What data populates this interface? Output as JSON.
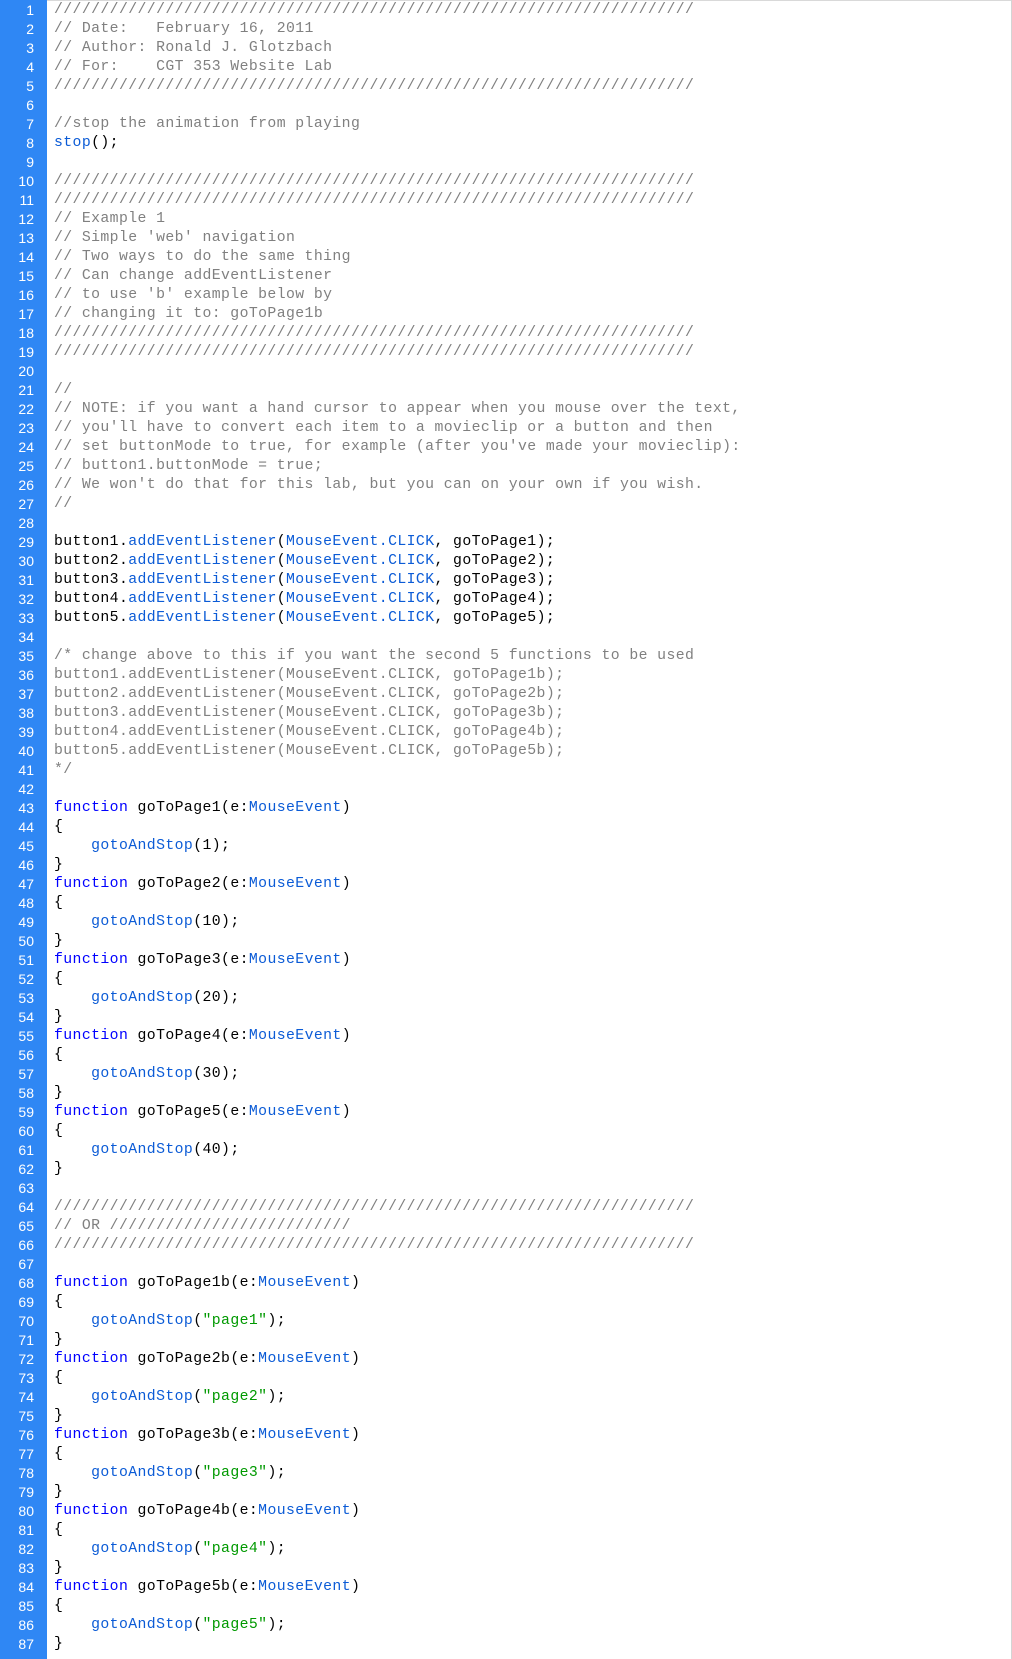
{
  "editor": {
    "colors": {
      "gutter": "#2f87f4",
      "comment": "#808080",
      "keyword": "#0000ff",
      "function": "#0b5bd6",
      "string": "#009900",
      "plain": "#000000"
    },
    "lines": [
      {
        "num": "1",
        "tokens": [
          {
            "t": "c",
            "v": "/////////////////////////////////////////////////////////////////////"
          }
        ]
      },
      {
        "num": "2",
        "tokens": [
          {
            "t": "c",
            "v": "// Date:   February 16, 2011"
          }
        ]
      },
      {
        "num": "3",
        "tokens": [
          {
            "t": "c",
            "v": "// Author: Ronald J. Glotzbach"
          }
        ]
      },
      {
        "num": "4",
        "tokens": [
          {
            "t": "c",
            "v": "// For:    CGT 353 Website Lab"
          }
        ]
      },
      {
        "num": "5",
        "tokens": [
          {
            "t": "c",
            "v": "/////////////////////////////////////////////////////////////////////"
          }
        ]
      },
      {
        "num": "6",
        "tokens": []
      },
      {
        "num": "7",
        "tokens": [
          {
            "t": "c",
            "v": "//stop the animation from playing"
          }
        ]
      },
      {
        "num": "8",
        "tokens": [
          {
            "t": "f",
            "v": "stop"
          },
          {
            "t": "p",
            "v": "();"
          }
        ]
      },
      {
        "num": "9",
        "tokens": []
      },
      {
        "num": "10",
        "tokens": [
          {
            "t": "c",
            "v": "/////////////////////////////////////////////////////////////////////"
          }
        ]
      },
      {
        "num": "11",
        "tokens": [
          {
            "t": "c",
            "v": "/////////////////////////////////////////////////////////////////////"
          }
        ]
      },
      {
        "num": "12",
        "tokens": [
          {
            "t": "c",
            "v": "// Example 1"
          }
        ]
      },
      {
        "num": "13",
        "tokens": [
          {
            "t": "c",
            "v": "// Simple 'web' navigation"
          }
        ]
      },
      {
        "num": "14",
        "tokens": [
          {
            "t": "c",
            "v": "// Two ways to do the same thing"
          }
        ]
      },
      {
        "num": "15",
        "tokens": [
          {
            "t": "c",
            "v": "// Can change addEventListener"
          }
        ]
      },
      {
        "num": "16",
        "tokens": [
          {
            "t": "c",
            "v": "// to use 'b' example below by"
          }
        ]
      },
      {
        "num": "17",
        "tokens": [
          {
            "t": "c",
            "v": "// changing it to: goToPage1b"
          }
        ]
      },
      {
        "num": "18",
        "tokens": [
          {
            "t": "c",
            "v": "/////////////////////////////////////////////////////////////////////"
          }
        ]
      },
      {
        "num": "19",
        "tokens": [
          {
            "t": "c",
            "v": "/////////////////////////////////////////////////////////////////////"
          }
        ]
      },
      {
        "num": "20",
        "tokens": []
      },
      {
        "num": "21",
        "tokens": [
          {
            "t": "c",
            "v": "//"
          }
        ]
      },
      {
        "num": "22",
        "tokens": [
          {
            "t": "c",
            "v": "// NOTE: if you want a hand cursor to appear when you mouse over the text,"
          }
        ]
      },
      {
        "num": "23",
        "tokens": [
          {
            "t": "c",
            "v": "// you'll have to convert each item to a movieclip or a button and then"
          }
        ]
      },
      {
        "num": "24",
        "tokens": [
          {
            "t": "c",
            "v": "// set buttonMode to true, for example (after you've made your movieclip):"
          }
        ]
      },
      {
        "num": "25",
        "tokens": [
          {
            "t": "c",
            "v": "// button1.buttonMode = true;"
          }
        ]
      },
      {
        "num": "26",
        "tokens": [
          {
            "t": "c",
            "v": "// We won't do that for this lab, but you can on your own if you wish."
          }
        ]
      },
      {
        "num": "27",
        "tokens": [
          {
            "t": "c",
            "v": "//"
          }
        ]
      },
      {
        "num": "28",
        "tokens": []
      },
      {
        "num": "29",
        "tokens": [
          {
            "t": "p",
            "v": "button1."
          },
          {
            "t": "f",
            "v": "addEventListener"
          },
          {
            "t": "p",
            "v": "("
          },
          {
            "t": "f",
            "v": "MouseEvent.CLICK"
          },
          {
            "t": "p",
            "v": ", goToPage1);"
          }
        ]
      },
      {
        "num": "30",
        "tokens": [
          {
            "t": "p",
            "v": "button2."
          },
          {
            "t": "f",
            "v": "addEventListener"
          },
          {
            "t": "p",
            "v": "("
          },
          {
            "t": "f",
            "v": "MouseEvent.CLICK"
          },
          {
            "t": "p",
            "v": ", goToPage2);"
          }
        ]
      },
      {
        "num": "31",
        "tokens": [
          {
            "t": "p",
            "v": "button3."
          },
          {
            "t": "f",
            "v": "addEventListener"
          },
          {
            "t": "p",
            "v": "("
          },
          {
            "t": "f",
            "v": "MouseEvent.CLICK"
          },
          {
            "t": "p",
            "v": ", goToPage3);"
          }
        ]
      },
      {
        "num": "32",
        "tokens": [
          {
            "t": "p",
            "v": "button4."
          },
          {
            "t": "f",
            "v": "addEventListener"
          },
          {
            "t": "p",
            "v": "("
          },
          {
            "t": "f",
            "v": "MouseEvent.CLICK"
          },
          {
            "t": "p",
            "v": ", goToPage4);"
          }
        ]
      },
      {
        "num": "33",
        "tokens": [
          {
            "t": "p",
            "v": "button5."
          },
          {
            "t": "f",
            "v": "addEventListener"
          },
          {
            "t": "p",
            "v": "("
          },
          {
            "t": "f",
            "v": "MouseEvent.CLICK"
          },
          {
            "t": "p",
            "v": ", goToPage5);"
          }
        ]
      },
      {
        "num": "34",
        "tokens": []
      },
      {
        "num": "35",
        "tokens": [
          {
            "t": "c",
            "v": "/* change above to this if you want the second 5 functions to be used"
          }
        ]
      },
      {
        "num": "36",
        "tokens": [
          {
            "t": "c",
            "v": "button1.addEventListener(MouseEvent.CLICK, goToPage1b);"
          }
        ]
      },
      {
        "num": "37",
        "tokens": [
          {
            "t": "c",
            "v": "button2.addEventListener(MouseEvent.CLICK, goToPage2b);"
          }
        ]
      },
      {
        "num": "38",
        "tokens": [
          {
            "t": "c",
            "v": "button3.addEventListener(MouseEvent.CLICK, goToPage3b);"
          }
        ]
      },
      {
        "num": "39",
        "tokens": [
          {
            "t": "c",
            "v": "button4.addEventListener(MouseEvent.CLICK, goToPage4b);"
          }
        ]
      },
      {
        "num": "40",
        "tokens": [
          {
            "t": "c",
            "v": "button5.addEventListener(MouseEvent.CLICK, goToPage5b);"
          }
        ]
      },
      {
        "num": "41",
        "tokens": [
          {
            "t": "c",
            "v": "*/"
          }
        ]
      },
      {
        "num": "42",
        "tokens": []
      },
      {
        "num": "43",
        "tokens": [
          {
            "t": "k",
            "v": "function"
          },
          {
            "t": "p",
            "v": " goToPage1(e:"
          },
          {
            "t": "y",
            "v": "MouseEvent"
          },
          {
            "t": "p",
            "v": ")"
          }
        ]
      },
      {
        "num": "44",
        "tokens": [
          {
            "t": "p",
            "v": "{"
          }
        ]
      },
      {
        "num": "45",
        "tokens": [
          {
            "t": "p",
            "v": "    "
          },
          {
            "t": "f",
            "v": "gotoAndStop"
          },
          {
            "t": "p",
            "v": "(1);"
          }
        ]
      },
      {
        "num": "46",
        "tokens": [
          {
            "t": "p",
            "v": "}"
          }
        ]
      },
      {
        "num": "47",
        "tokens": [
          {
            "t": "k",
            "v": "function"
          },
          {
            "t": "p",
            "v": " goToPage2(e:"
          },
          {
            "t": "y",
            "v": "MouseEvent"
          },
          {
            "t": "p",
            "v": ")"
          }
        ]
      },
      {
        "num": "48",
        "tokens": [
          {
            "t": "p",
            "v": "{"
          }
        ]
      },
      {
        "num": "49",
        "tokens": [
          {
            "t": "p",
            "v": "    "
          },
          {
            "t": "f",
            "v": "gotoAndStop"
          },
          {
            "t": "p",
            "v": "(10);"
          }
        ]
      },
      {
        "num": "50",
        "tokens": [
          {
            "t": "p",
            "v": "}"
          }
        ]
      },
      {
        "num": "51",
        "tokens": [
          {
            "t": "k",
            "v": "function"
          },
          {
            "t": "p",
            "v": " goToPage3(e:"
          },
          {
            "t": "y",
            "v": "MouseEvent"
          },
          {
            "t": "p",
            "v": ")"
          }
        ]
      },
      {
        "num": "52",
        "tokens": [
          {
            "t": "p",
            "v": "{"
          }
        ]
      },
      {
        "num": "53",
        "tokens": [
          {
            "t": "p",
            "v": "    "
          },
          {
            "t": "f",
            "v": "gotoAndStop"
          },
          {
            "t": "p",
            "v": "(20);"
          }
        ]
      },
      {
        "num": "54",
        "tokens": [
          {
            "t": "p",
            "v": "}"
          }
        ]
      },
      {
        "num": "55",
        "tokens": [
          {
            "t": "k",
            "v": "function"
          },
          {
            "t": "p",
            "v": " goToPage4(e:"
          },
          {
            "t": "y",
            "v": "MouseEvent"
          },
          {
            "t": "p",
            "v": ")"
          }
        ]
      },
      {
        "num": "56",
        "tokens": [
          {
            "t": "p",
            "v": "{"
          }
        ]
      },
      {
        "num": "57",
        "tokens": [
          {
            "t": "p",
            "v": "    "
          },
          {
            "t": "f",
            "v": "gotoAndStop"
          },
          {
            "t": "p",
            "v": "(30);"
          }
        ]
      },
      {
        "num": "58",
        "tokens": [
          {
            "t": "p",
            "v": "}"
          }
        ]
      },
      {
        "num": "59",
        "tokens": [
          {
            "t": "k",
            "v": "function"
          },
          {
            "t": "p",
            "v": " goToPage5(e:"
          },
          {
            "t": "y",
            "v": "MouseEvent"
          },
          {
            "t": "p",
            "v": ")"
          }
        ]
      },
      {
        "num": "60",
        "tokens": [
          {
            "t": "p",
            "v": "{"
          }
        ]
      },
      {
        "num": "61",
        "tokens": [
          {
            "t": "p",
            "v": "    "
          },
          {
            "t": "f",
            "v": "gotoAndStop"
          },
          {
            "t": "p",
            "v": "(40);"
          }
        ]
      },
      {
        "num": "62",
        "tokens": [
          {
            "t": "p",
            "v": "}"
          }
        ]
      },
      {
        "num": "63",
        "tokens": []
      },
      {
        "num": "64",
        "tokens": [
          {
            "t": "c",
            "v": "/////////////////////////////////////////////////////////////////////"
          }
        ]
      },
      {
        "num": "65",
        "tokens": [
          {
            "t": "c",
            "v": "// OR //////////////////////////"
          }
        ]
      },
      {
        "num": "66",
        "tokens": [
          {
            "t": "c",
            "v": "/////////////////////////////////////////////////////////////////////"
          }
        ]
      },
      {
        "num": "67",
        "tokens": []
      },
      {
        "num": "68",
        "tokens": [
          {
            "t": "k",
            "v": "function"
          },
          {
            "t": "p",
            "v": " goToPage1b(e:"
          },
          {
            "t": "y",
            "v": "MouseEvent"
          },
          {
            "t": "p",
            "v": ")"
          }
        ]
      },
      {
        "num": "69",
        "tokens": [
          {
            "t": "p",
            "v": "{"
          }
        ]
      },
      {
        "num": "70",
        "tokens": [
          {
            "t": "p",
            "v": "    "
          },
          {
            "t": "f",
            "v": "gotoAndStop"
          },
          {
            "t": "p",
            "v": "("
          },
          {
            "t": "s",
            "v": "\"page1\""
          },
          {
            "t": "p",
            "v": ");"
          }
        ]
      },
      {
        "num": "71",
        "tokens": [
          {
            "t": "p",
            "v": "}"
          }
        ]
      },
      {
        "num": "72",
        "tokens": [
          {
            "t": "k",
            "v": "function"
          },
          {
            "t": "p",
            "v": " goToPage2b(e:"
          },
          {
            "t": "y",
            "v": "MouseEvent"
          },
          {
            "t": "p",
            "v": ")"
          }
        ]
      },
      {
        "num": "73",
        "tokens": [
          {
            "t": "p",
            "v": "{"
          }
        ]
      },
      {
        "num": "74",
        "tokens": [
          {
            "t": "p",
            "v": "    "
          },
          {
            "t": "f",
            "v": "gotoAndStop"
          },
          {
            "t": "p",
            "v": "("
          },
          {
            "t": "s",
            "v": "\"page2\""
          },
          {
            "t": "p",
            "v": ");"
          }
        ]
      },
      {
        "num": "75",
        "tokens": [
          {
            "t": "p",
            "v": "}"
          }
        ]
      },
      {
        "num": "76",
        "tokens": [
          {
            "t": "k",
            "v": "function"
          },
          {
            "t": "p",
            "v": " goToPage3b(e:"
          },
          {
            "t": "y",
            "v": "MouseEvent"
          },
          {
            "t": "p",
            "v": ")"
          }
        ]
      },
      {
        "num": "77",
        "tokens": [
          {
            "t": "p",
            "v": "{"
          }
        ]
      },
      {
        "num": "78",
        "tokens": [
          {
            "t": "p",
            "v": "    "
          },
          {
            "t": "f",
            "v": "gotoAndStop"
          },
          {
            "t": "p",
            "v": "("
          },
          {
            "t": "s",
            "v": "\"page3\""
          },
          {
            "t": "p",
            "v": ");"
          }
        ]
      },
      {
        "num": "79",
        "tokens": [
          {
            "t": "p",
            "v": "}"
          }
        ]
      },
      {
        "num": "80",
        "tokens": [
          {
            "t": "k",
            "v": "function"
          },
          {
            "t": "p",
            "v": " goToPage4b(e:"
          },
          {
            "t": "y",
            "v": "MouseEvent"
          },
          {
            "t": "p",
            "v": ")"
          }
        ]
      },
      {
        "num": "81",
        "tokens": [
          {
            "t": "p",
            "v": "{"
          }
        ]
      },
      {
        "num": "82",
        "tokens": [
          {
            "t": "p",
            "v": "    "
          },
          {
            "t": "f",
            "v": "gotoAndStop"
          },
          {
            "t": "p",
            "v": "("
          },
          {
            "t": "s",
            "v": "\"page4\""
          },
          {
            "t": "p",
            "v": ");"
          }
        ]
      },
      {
        "num": "83",
        "tokens": [
          {
            "t": "p",
            "v": "}"
          }
        ]
      },
      {
        "num": "84",
        "tokens": [
          {
            "t": "k",
            "v": "function"
          },
          {
            "t": "p",
            "v": " goToPage5b(e:"
          },
          {
            "t": "y",
            "v": "MouseEvent"
          },
          {
            "t": "p",
            "v": ")"
          }
        ]
      },
      {
        "num": "85",
        "tokens": [
          {
            "t": "p",
            "v": "{"
          }
        ]
      },
      {
        "num": "86",
        "tokens": [
          {
            "t": "p",
            "v": "    "
          },
          {
            "t": "f",
            "v": "gotoAndStop"
          },
          {
            "t": "p",
            "v": "("
          },
          {
            "t": "s",
            "v": "\"page5\""
          },
          {
            "t": "p",
            "v": ");"
          }
        ]
      },
      {
        "num": "87",
        "tokens": [
          {
            "t": "p",
            "v": "}"
          }
        ]
      }
    ]
  }
}
